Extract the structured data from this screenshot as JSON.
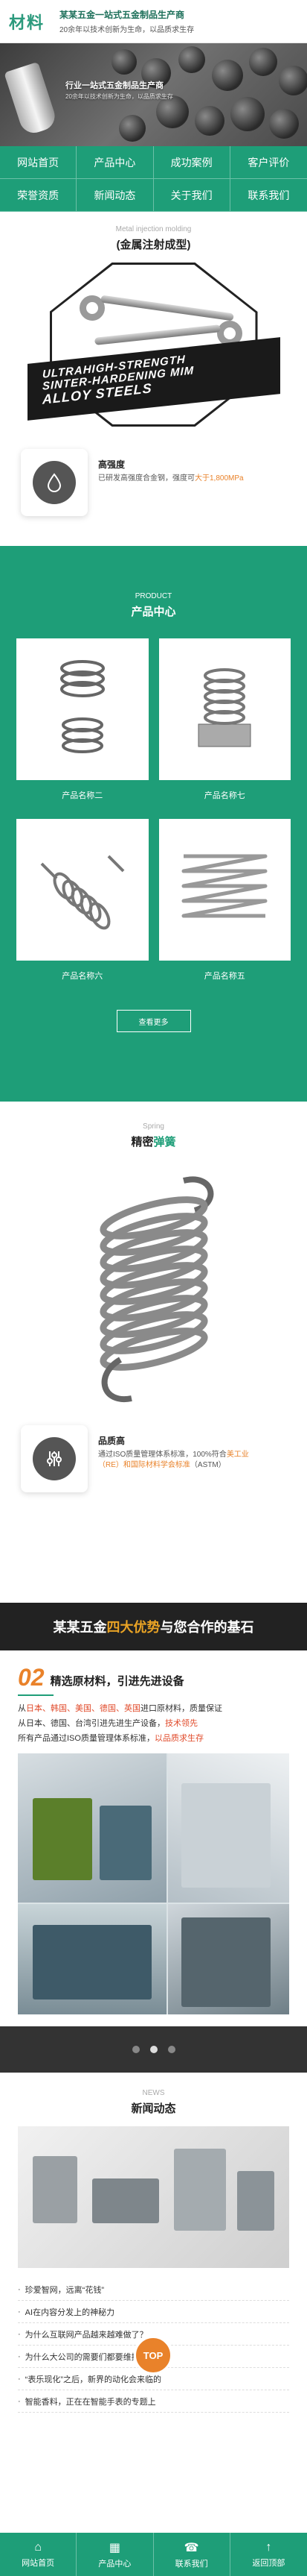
{
  "header": {
    "logo": "材料",
    "slogan_title": "某某五金一站式五金制品生产商",
    "slogan_sub": "20余年以技术创新为生命，以品质求生存"
  },
  "banner": {
    "title": "行业一站式五金制品生产商",
    "subtitle": "20余年以技术创新为生命，以品质求生存"
  },
  "nav": [
    "网站首页",
    "产品中心",
    "成功案例",
    "客户评价",
    "荣誉资质",
    "新闻动态",
    "关于我们",
    "联系我们"
  ],
  "mim": {
    "en": "Metal injection molding",
    "cn": "(金属注射成型)",
    "image_text": [
      "ULTRAHIGH-STRENGTH",
      "SINTER-HARDENING MIM",
      "ALLOY STEELS"
    ]
  },
  "feature_strength": {
    "icon": "droplet-icon",
    "title": "高强度",
    "desc_prefix": "已研发高强度合金钢，强度可",
    "desc_accent": "大于1,800MPa"
  },
  "products": {
    "en": "PRODUCT",
    "cn": "产品中心",
    "items": [
      {
        "name": "产品名称二"
      },
      {
        "name": "产品名称七"
      },
      {
        "name": "产品名称六"
      },
      {
        "name": "产品名称五"
      }
    ],
    "more": "查看更多"
  },
  "spring": {
    "en": "Spring",
    "cn_prefix": "精密",
    "cn_accent": "弹簧"
  },
  "feature_quality": {
    "icon": "sliders-icon",
    "title": "品质高",
    "desc_prefix": "通过ISO质量管理体系标准，100%符合",
    "desc_accent": "ASTM",
    "desc_accent_prefix": "美工业（RE）和国际材料学会标准",
    "desc_suffix": "（ASTM）"
  },
  "advantages": {
    "banner_prefix": "某某五金",
    "banner_accent": "四大优势",
    "banner_suffix": "与您合作的基石",
    "num": "02",
    "title": "精选原材料，引进先进设备",
    "items": [
      {
        "pre": "从",
        "red": "日本、韩国、美国、德国、英国",
        "post": "进口原材料，质量保证"
      },
      {
        "pre": "从日本、德国、台湾引进先进生产设备，",
        "red": "技术领先",
        "post": ""
      },
      {
        "pre": "所有产品通过ISO质量管理体系标准，",
        "red": "以品质求生存",
        "post": ""
      }
    ]
  },
  "news": {
    "en": "NEWS",
    "cn": "新闻动态",
    "top_label": "TOP",
    "items": [
      "珍爱智网，远离“花钱”",
      "AI在内容分发上的神秘力",
      "为什么互联网产品越来越难做了？",
      "为什么大公司的需要们都要维持等？",
      "“表乐现化”之后，新界的动化会来临的",
      "智能香料，正在在智能手表的专题上"
    ]
  },
  "bottom_bar": [
    {
      "icon": "home-icon",
      "label": "网站首页"
    },
    {
      "icon": "grid-icon",
      "label": "产品中心"
    },
    {
      "icon": "phone-icon",
      "label": "联系我们"
    },
    {
      "icon": "arrow-up-icon",
      "label": "返回顶部"
    }
  ],
  "colors": {
    "brand_green": "#1e9e78",
    "accent_orange": "#e9822a",
    "accent_red": "#e04a2a",
    "dark_bar": "#222222"
  }
}
